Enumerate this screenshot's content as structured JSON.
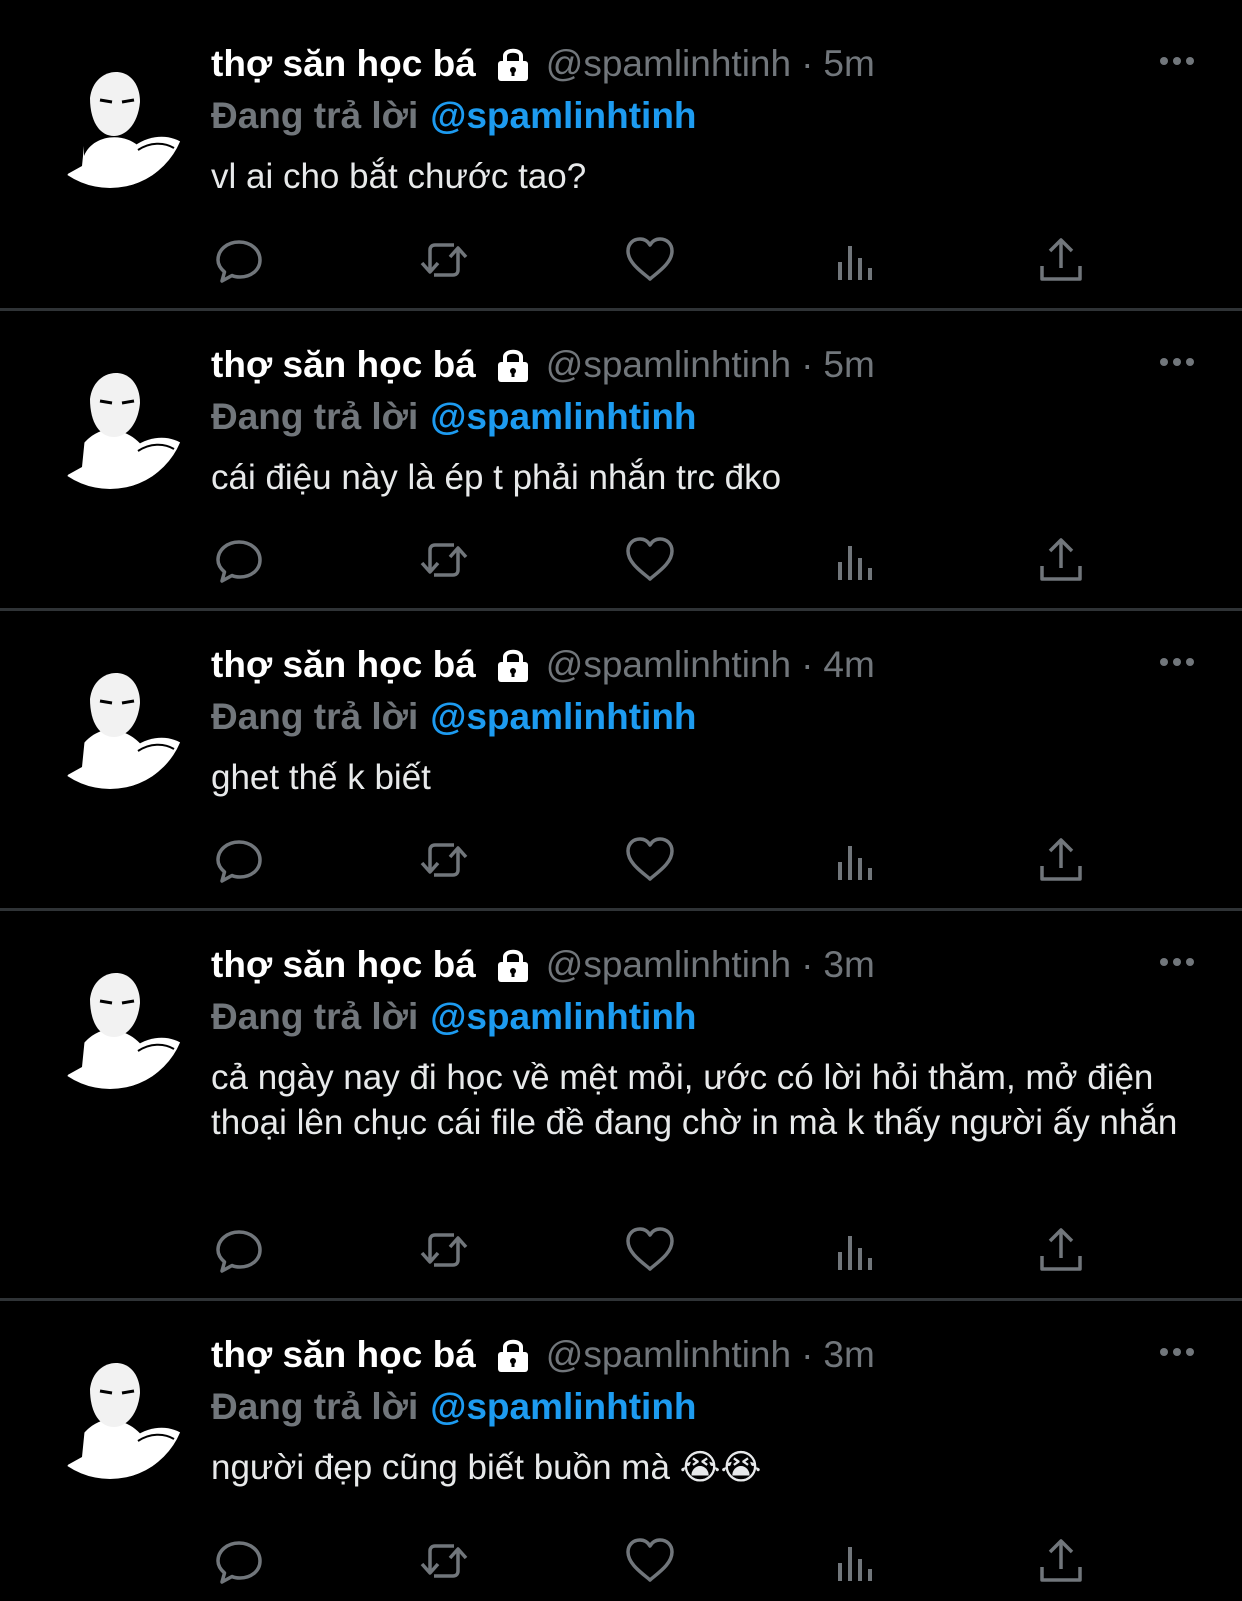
{
  "colors": {
    "background": "#000000",
    "divider": "#2f3336",
    "primary_text": "#e7e9ea",
    "secondary_text": "#71767b",
    "accent": "#1d9bf0"
  },
  "icons": {
    "lock": "lock-icon",
    "more": "more-icon",
    "reply": "reply-icon",
    "retweet": "retweet-icon",
    "like": "heart-icon",
    "views": "bar-chart-icon",
    "share": "share-icon"
  },
  "tweets": [
    {
      "display_name": "thợ săn học bá",
      "handle": "@spamlinhtinh",
      "separator": "·",
      "time": "5m",
      "reply_prefix": "Đang trả lời",
      "reply_to": "@spamlinhtinh",
      "text": "vl ai cho bắt chước tao?"
    },
    {
      "display_name": "thợ săn học bá",
      "handle": "@spamlinhtinh",
      "separator": "·",
      "time": "5m",
      "reply_prefix": "Đang trả lời",
      "reply_to": "@spamlinhtinh",
      "text": "cái điệu này là ép t phải nhắn trc đko"
    },
    {
      "display_name": "thợ săn học bá",
      "handle": "@spamlinhtinh",
      "separator": "·",
      "time": "4m",
      "reply_prefix": "Đang trả lời",
      "reply_to": "@spamlinhtinh",
      "text": "ghet thế k biết"
    },
    {
      "display_name": "thợ săn học bá",
      "handle": "@spamlinhtinh",
      "separator": "·",
      "time": "3m",
      "reply_prefix": "Đang trả lời",
      "reply_to": "@spamlinhtinh",
      "text": "cả ngày nay đi học về mệt mỏi, ước có lời hỏi thăm, mở điện thoại lên chục cái file đề đang chờ in mà k thấy người ấy nhắn"
    },
    {
      "display_name": "thợ săn học bá",
      "handle": "@spamlinhtinh",
      "separator": "·",
      "time": "3m",
      "reply_prefix": "Đang trả lời",
      "reply_to": "@spamlinhtinh",
      "text": "người đẹp cũng biết buồn mà 😭😭"
    }
  ]
}
